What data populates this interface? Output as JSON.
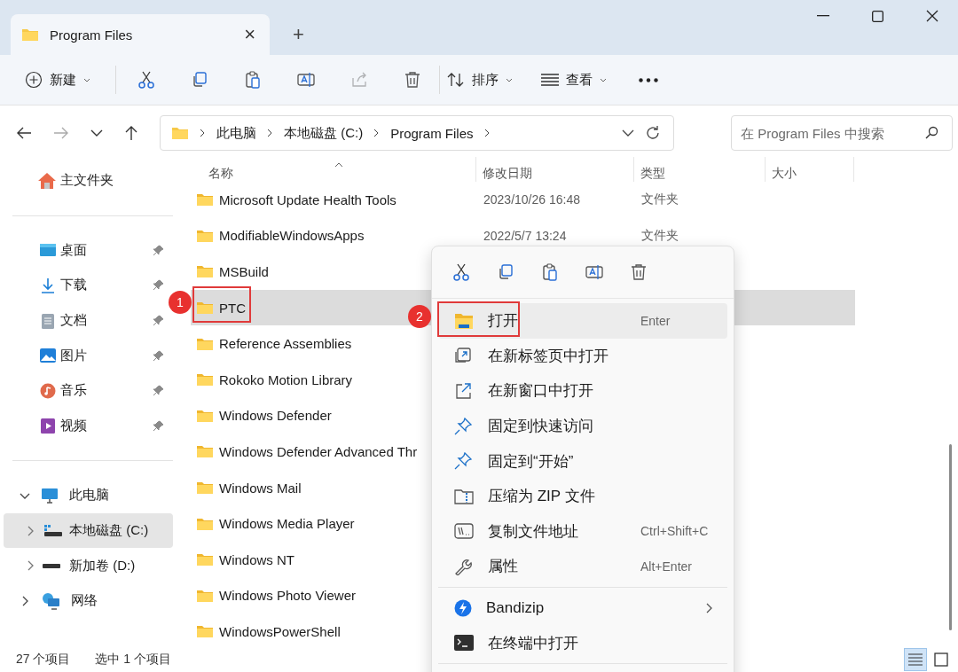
{
  "tab": {
    "title": "Program Files",
    "close": "×",
    "new_tab": "+"
  },
  "toolbar": {
    "new_button": {
      "label": "新建"
    },
    "icon_buttons": [
      {
        "disabled": false
      },
      {
        "disabled": false
      },
      {
        "disabled": false
      },
      {
        "disabled": false
      },
      {
        "disabled": true
      },
      {
        "disabled": false
      }
    ],
    "sort_button": {
      "label": "排序"
    },
    "view_button": {
      "label": "查看"
    }
  },
  "nav": {
    "back_disabled": false,
    "forward_disabled": true
  },
  "breadcrumb": [
    "此电脑",
    "本地磁盘 (C:)",
    "Program Files"
  ],
  "search": {
    "placeholder": "在 Program Files 中搜索"
  },
  "sidebar": {
    "home": "主文件夹",
    "pinned": [
      {
        "label": "桌面",
        "pinned": true
      },
      {
        "label": "下载",
        "pinned": true
      },
      {
        "label": "文档",
        "pinned": true
      },
      {
        "label": "图片",
        "pinned": true
      },
      {
        "label": "音乐",
        "pinned": true
      },
      {
        "label": "视频",
        "pinned": true
      }
    ],
    "tree": [
      {
        "label": "此电脑",
        "expanded": true,
        "selected": false,
        "children": [
          {
            "label": "本地磁盘 (C:)",
            "expanded": false,
            "selected": true
          },
          {
            "label": "新加卷 (D:)",
            "expanded": false,
            "selected": false
          }
        ]
      },
      {
        "label": "网络",
        "expanded": false,
        "selected": false
      }
    ]
  },
  "columns": [
    "名称",
    "修改日期",
    "类型",
    "大小"
  ],
  "files": [
    {
      "name": "Microsoft Update Health Tools",
      "date": "2023/10/26 16:48",
      "type": "文件夹",
      "selected": false
    },
    {
      "name": "ModifiableWindowsApps",
      "date": "2022/5/7 13:24",
      "type": "文件夹",
      "selected": false
    },
    {
      "name": "MSBuild",
      "selected": false
    },
    {
      "name": "PTC",
      "selected": true
    },
    {
      "name": "Reference Assemblies",
      "selected": false
    },
    {
      "name": "Rokoko Motion Library",
      "selected": false
    },
    {
      "name": "Windows Defender",
      "selected": false
    },
    {
      "name": "Windows Defender Advanced Thr",
      "selected": false
    },
    {
      "name": "Windows Mail",
      "selected": false
    },
    {
      "name": "Windows Media Player",
      "selected": false
    },
    {
      "name": "Windows NT",
      "selected": false
    },
    {
      "name": "Windows Photo Viewer",
      "selected": false
    },
    {
      "name": "WindowsPowerShell",
      "selected": false
    }
  ],
  "status": {
    "count": "27 个项目",
    "selection": "选中 1 个项目"
  },
  "view_modes": [
    {
      "selected": true
    },
    {
      "selected": false
    }
  ],
  "context_menu": {
    "items": [
      {
        "label": "打开",
        "shortcut": "Enter",
        "selected": true
      },
      {
        "label": "在新标签页中打开",
        "selected": false
      },
      {
        "label": "在新窗口中打开",
        "selected": false
      },
      {
        "label": "固定到快速访问",
        "selected": false
      },
      {
        "label": "固定到“开始”",
        "selected": false
      },
      {
        "label": "压缩为 ZIP 文件",
        "selected": false
      },
      {
        "label": "复制文件地址",
        "shortcut": "Ctrl+Shift+C",
        "selected": false
      },
      {
        "label": "属性",
        "shortcut": "Alt+Enter",
        "selected": false
      }
    ],
    "extra_items": [
      {
        "label": "Bandizip",
        "submenu": true
      },
      {
        "label": "在终端中打开",
        "submenu": false
      }
    ]
  },
  "callouts": [
    "1",
    "2"
  ]
}
